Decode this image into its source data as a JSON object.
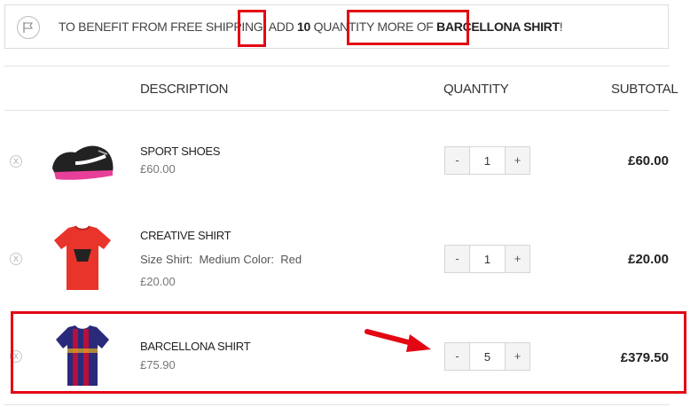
{
  "notice": {
    "prefix": "TO BENEFIT FROM FREE SHIPPING, ADD",
    "quantity": "10",
    "middle": "QUANTITY MORE OF",
    "product": "BARCELLONA SHIRT",
    "suffix": "!",
    "icon": "flag-icon"
  },
  "columns": {
    "description": "DESCRIPTION",
    "quantity": "QUANTITY",
    "subtotal": "SUBTOTAL"
  },
  "items": [
    {
      "remove_label": "X",
      "name": "SPORT SHOES",
      "price": "£60.00",
      "attributes": "",
      "qty_minus": "-",
      "qty": "1",
      "qty_plus": "+",
      "subtotal": "£60.00"
    },
    {
      "remove_label": "X",
      "name": "CREATIVE SHIRT",
      "price": "£20.00",
      "attributes": "Size Shirt:  Medium Color:  Red",
      "qty_minus": "-",
      "qty": "1",
      "qty_plus": "+",
      "subtotal": "£20.00"
    },
    {
      "remove_label": "X",
      "name": "BARCELLONA SHIRT",
      "price": "£75.90",
      "attributes": "",
      "qty_minus": "-",
      "qty": "5",
      "qty_plus": "+",
      "subtotal": "£379.50"
    }
  ],
  "colors": {
    "highlight": "#e30613",
    "border": "#e2e2e2"
  }
}
